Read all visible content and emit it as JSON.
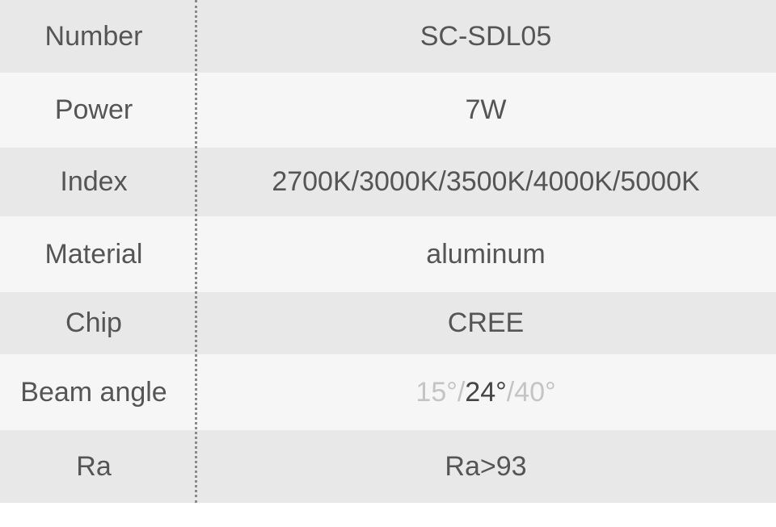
{
  "colors": {
    "row_dark": "#e8e8e8",
    "row_light": "#f6f6f6",
    "text": "#555555",
    "muted_text": "#c4c4c4",
    "divider": "#8a8a8a"
  },
  "specs": [
    {
      "label": "Number",
      "value": "SC-SDL05"
    },
    {
      "label": "Power",
      "value": "7W"
    },
    {
      "label": "Index",
      "value": "2700K/3000K/3500K/4000K/5000K"
    },
    {
      "label": "Material",
      "value": "aluminum"
    },
    {
      "label": "Chip",
      "value": "CREE"
    },
    {
      "label": "Beam angle",
      "value_parts": [
        {
          "text": "15°",
          "selected": false
        },
        {
          "text": "/",
          "selected": false
        },
        {
          "text": "24°",
          "selected": true
        },
        {
          "text": "/",
          "selected": false
        },
        {
          "text": "40°",
          "selected": false
        }
      ]
    },
    {
      "label": "Ra",
      "value": "Ra>93"
    }
  ]
}
